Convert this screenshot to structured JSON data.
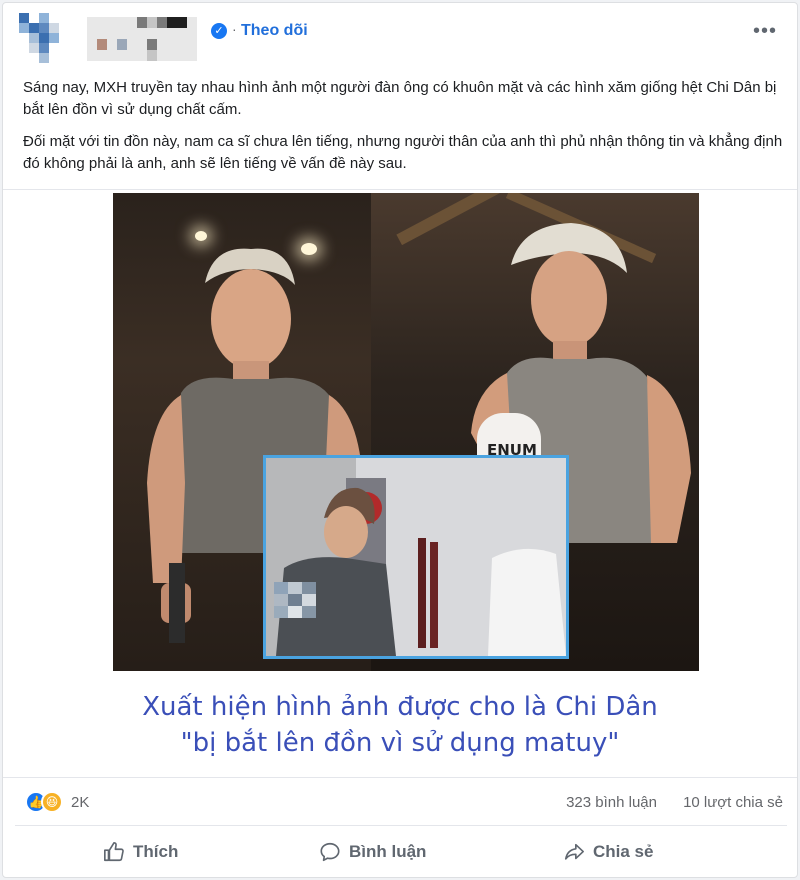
{
  "header": {
    "follow_label": "Theo dõi",
    "verified_icon": "✓",
    "dot": "·",
    "more_label": "•••",
    "avatar_colors": [
      "#3b6fb0",
      "#8fb3d9",
      "#cfd8e3",
      "#ffffff",
      "#5e89bf",
      "#a7bfd9"
    ],
    "name_colors": [
      "#1f1f1f",
      "#7a7a7a",
      "#c5c5c5",
      "#e8e8e8",
      "#b38a7a",
      "#9aa7b8"
    ]
  },
  "post": {
    "paragraph_1": "Sáng nay, MXH truyền tay nhau hình ảnh một người đàn ông có khuôn mặt và các hình xăm giống hệt Chi Dân bị bắt lên đồn vì sử dụng chất cấm.",
    "paragraph_2": "Đối mặt với tin đồn này, nam ca sĩ chưa lên tiếng, nhưng người thân của anh thì phủ nhận thông tin và khẳng định đó không phải là anh, anh sẽ lên tiếng về vấn đề này sau."
  },
  "image": {
    "glove_text": "ENUM",
    "caption_line_1": "Xuất hiện hình ảnh được cho là Chi Dân",
    "caption_line_2": "\"bị bắt lên đồn vì sử dụng matuy\""
  },
  "stats": {
    "reaction_count": "2K",
    "comments": "323 bình luận",
    "shares": "10 lượt chia sẻ",
    "like_icon": "like-reaction-icon",
    "haha_icon": "haha-reaction-icon"
  },
  "actions": {
    "like_label": "Thích",
    "comment_label": "Bình luận",
    "share_label": "Chia sẻ"
  },
  "colors": {
    "accent": "#1877f2",
    "follow": "#216fdb",
    "caption": "#3a4fb8",
    "inset_border": "#4aa3e0"
  }
}
